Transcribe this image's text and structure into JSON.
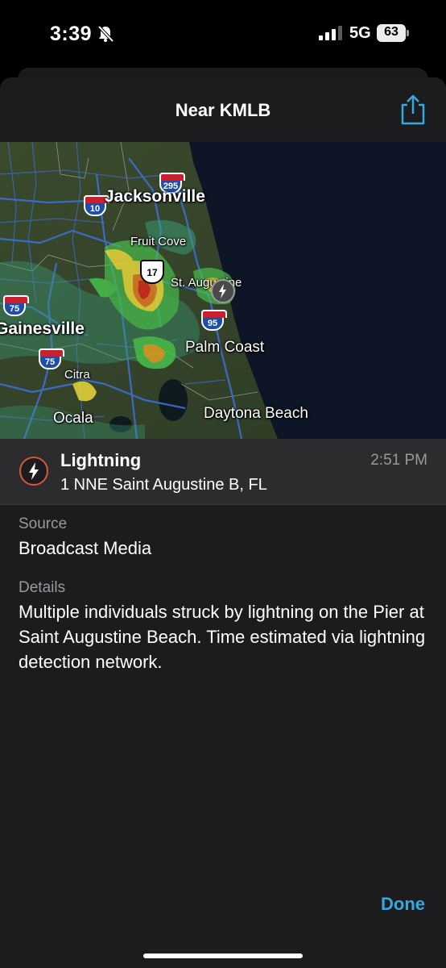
{
  "status_bar": {
    "time": "3:39",
    "network": "5G",
    "battery": "63"
  },
  "nav": {
    "title": "Near KMLB"
  },
  "map": {
    "labels": {
      "jacksonville": "Jacksonville",
      "fruit_cove": "Fruit Cove",
      "st_augustine": "St. Augustine",
      "gainesville": "Gainesville",
      "palm_coast": "Palm Coast",
      "citra": "Citra",
      "ocala": "Ocala",
      "daytona_beach": "Daytona Beach"
    },
    "shields": {
      "i295": "295",
      "i10": "10",
      "us17": "17",
      "i75_north": "75",
      "i95": "95",
      "i75_south": "75"
    }
  },
  "event": {
    "title": "Lightning",
    "location": "1 NNE Saint Augustine B, FL",
    "time": "2:51 PM"
  },
  "source": {
    "label": "Source",
    "value": "Broadcast Media"
  },
  "details": {
    "label": "Details",
    "value": "Multiple individuals struck by lightning on the Pier at Saint Augustine Beach. Time estimated via lightning detection network."
  },
  "done_label": "Done",
  "colors": {
    "accent": "#35a8e0",
    "lightning": "#d9543c",
    "sheet": "#1c1c1e"
  }
}
